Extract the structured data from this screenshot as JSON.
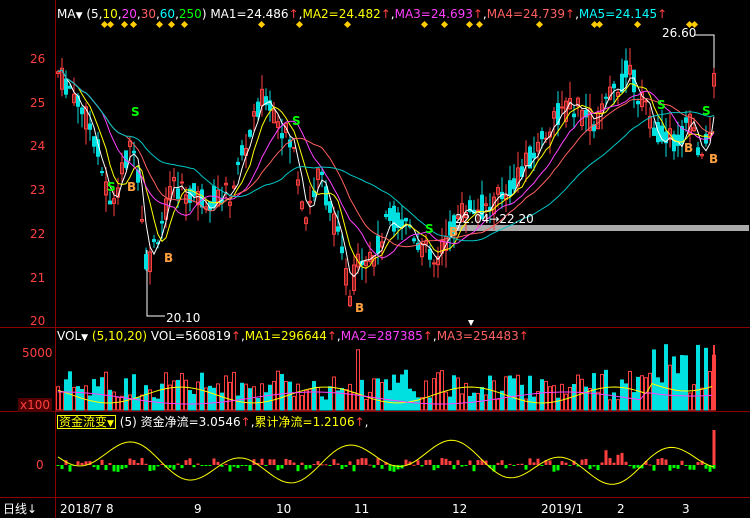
{
  "colors": {
    "bg": "#000000",
    "up": "#ff4040",
    "down": "#00e0e0",
    "grid": "#8b0000",
    "white": "#ffffff",
    "yellow": "#ffff00",
    "magenta": "#ff40ff",
    "green": "#00ff00",
    "cyan": "#00ffff",
    "orange": "#ffa040"
  },
  "price_panel": {
    "ma_menu": "MA",
    "ma_params_open": "(",
    "ma_params": [
      "5",
      "10",
      "20",
      "30",
      "60",
      "250"
    ],
    "ma_params_close": ")",
    "ma1": "MA1=24.486",
    "ma2": "MA2=24.482",
    "ma3": "MA3=24.693",
    "ma4": "MA4=24.739",
    "ma5": "MA5=24.145",
    "arrow": "↑",
    "y_ticks": [
      "26",
      "25",
      "24",
      "23",
      "22",
      "21",
      "20"
    ],
    "high_label": "26.60",
    "low_label": "20.10",
    "mid_label": "22.04→22.20",
    "signal_s": "S",
    "signal_b": "B"
  },
  "volume_panel": {
    "menu": "VOL",
    "params": "(5,10,20)",
    "vol": "VOL=560819",
    "ma1": "MA1=296644",
    "ma2": "MA2=287385",
    "ma3": "MA3=254483",
    "arrow": "↑",
    "y_ticks": [
      "5000"
    ],
    "unit": "x100"
  },
  "flow_panel": {
    "menu": "资金流变",
    "params": "(5)",
    "net": "资金净流=3.0546",
    "cum": "累计净流=1.2106",
    "arrow": "↑",
    "tail": ",",
    "y_ticks": [
      "0"
    ]
  },
  "bottom_bar": {
    "period": "日线",
    "period_arrow": "↓",
    "x_labels": [
      "2018/7",
      "8",
      "9",
      "10",
      "11",
      "12",
      "2019/1",
      "2",
      "3"
    ]
  }
}
